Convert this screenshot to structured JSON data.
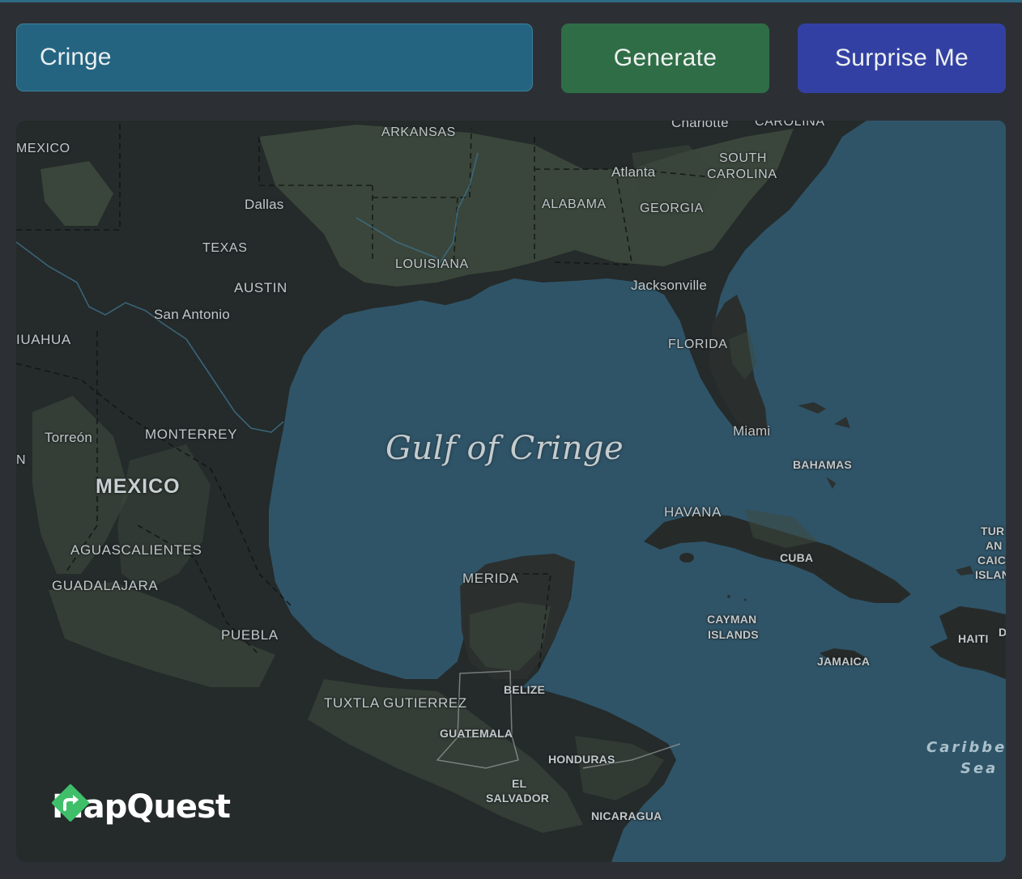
{
  "search": {
    "value": "Cringe"
  },
  "buttons": {
    "generate": "Generate",
    "surprise": "Surprise Me"
  },
  "map": {
    "water_title": "Gulf of Cringe",
    "sea_label_line1": "Caribbe",
    "sea_label_line2": "Sea",
    "provider": "MapQuest",
    "labels": {
      "new_mexico": "MEXICO",
      "arkansas": "ARKANSAS",
      "charlotte": "Charlotte",
      "carolina": "CAROLINA",
      "south": "SOUTH",
      "south_carolina": "CAROLINA",
      "atlanta": "Atlanta",
      "dallas": "Dallas",
      "alabama": "ALABAMA",
      "georgia": "GEORGIA",
      "texas": "TEXAS",
      "louisiana": "LOUISIANA",
      "austin": "AUSTIN",
      "jacksonville": "Jacksonville",
      "san_antonio": "San Antonio",
      "chihuahua": "IUAHUA",
      "florida": "FLORIDA",
      "miami": "Miami",
      "torreon": "Torreón",
      "monterrey": "MONTERREY",
      "n": "N",
      "bahamas": "BAHAMAS",
      "mexico": "MEXICO",
      "havana": "HAVANA",
      "aguascalientes": "AGUASCALIENTES",
      "tur": "TUR",
      "an": "AN",
      "caic": "CAIC",
      "islan": "ISLAN",
      "cuba": "CUBA",
      "guadalajara": "GUADALAJARA",
      "merida": "MERIDA",
      "cayman": "CAYMAN",
      "islands": "ISLANDS",
      "puebla": "PUEBLA",
      "haiti": "HAITI",
      "d": "D",
      "jamaica": "JAMAICA",
      "belize": "BELIZE",
      "tuxtla": "TUXTLA GUTIERREZ",
      "guatemala": "GUATEMALA",
      "honduras": "HONDURAS",
      "el": "EL",
      "salvador": "SALVADOR",
      "nicaragua": "NICARAGUA"
    },
    "colors": {
      "water": "#2f5468",
      "land": "#252a2a",
      "vegetation": "#3e4a3e",
      "label": "#c2c8ca",
      "brand_green": "#3fbf6a"
    }
  }
}
